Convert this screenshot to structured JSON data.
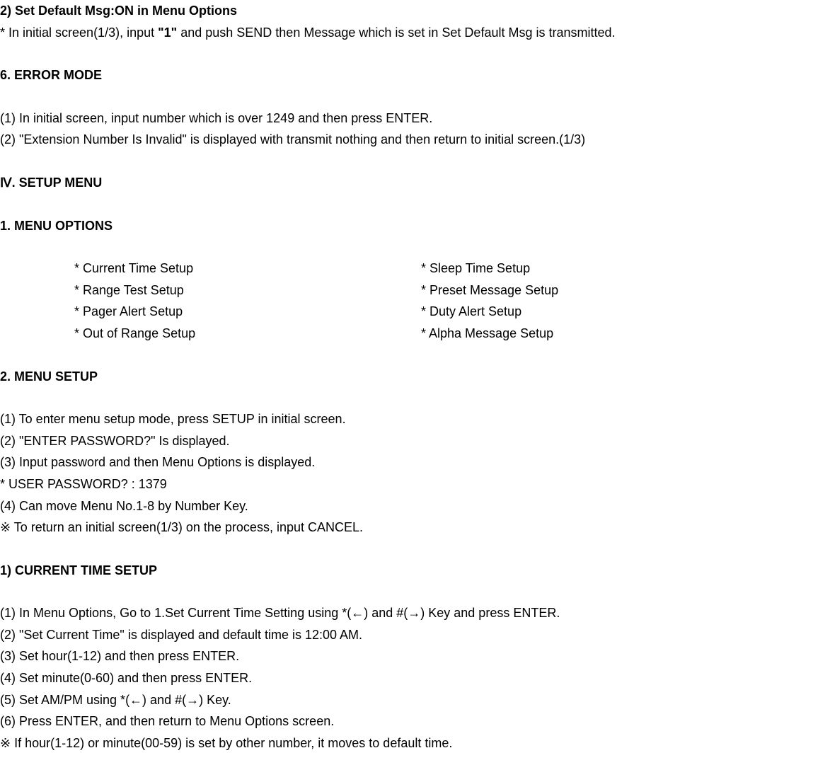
{
  "line1_prefix": "2) Set Default Msg:ON in Menu Options",
  "line2_a": " * In initial screen(1/3), input ",
  "line2_b": "\"1\"",
  "line2_c": " and push SEND then Message which is set in Set Default Msg is transmitted.",
  "line3": "6. ERROR MODE",
  "line4": "(1) In initial screen, input number which is over 1249 and then press ENTER.",
  "line5": "(2) \"Extension Number Is Invalid\" is displayed with transmit nothing and then return to initial screen.(1/3)",
  "sectionIV": "Ⅳ. SETUP MENU",
  "line6": "1. MENU OPTIONS",
  "options": {
    "left": [
      "* Current Time Setup",
      "* Range Test Setup",
      "* Pager Alert Setup",
      "* Out of Range Setup"
    ],
    "right": [
      "* Sleep Time Setup",
      "* Preset Message Setup",
      "* Duty Alert Setup",
      "* Alpha Message Setup"
    ]
  },
  "line7": "2. MENU SETUP",
  "line8": "(1) To enter menu setup mode, press SETUP in initial screen.",
  "line9": "(2) \"ENTER PASSWORD?\" Is displayed.",
  "line10": "(3) Input password and then Menu Options is displayed.",
  "line11": "   * USER PASSWORD? : 1379",
  "line12": "(4) Can move Menu No.1-8 by Number Key.",
  "line13": "※ To return an initial screen(1/3) on the process, input CANCEL.",
  "line14": "1) CURRENT TIME SETUP",
  "line15": "(1)  In Menu Options, Go to 1.Set Current Time Setting using *(←) and #(→) Key and press ENTER.",
  "line16": "(2) \"Set Current Time\" is displayed and default time is 12:00 AM.",
  "line17": "(3) Set hour(1-12) and then press ENTER.",
  "line18": "(4) Set minute(0-60) and then press ENTER.",
  "line19": "(5) Set AM/PM using *(←) and #(→) Key.",
  "line20": "(6) Press ENTER, and then return to Menu Options screen.",
  "line21": "※ If hour(1-12) or minute(00-59) is set by other number, it moves to default time."
}
